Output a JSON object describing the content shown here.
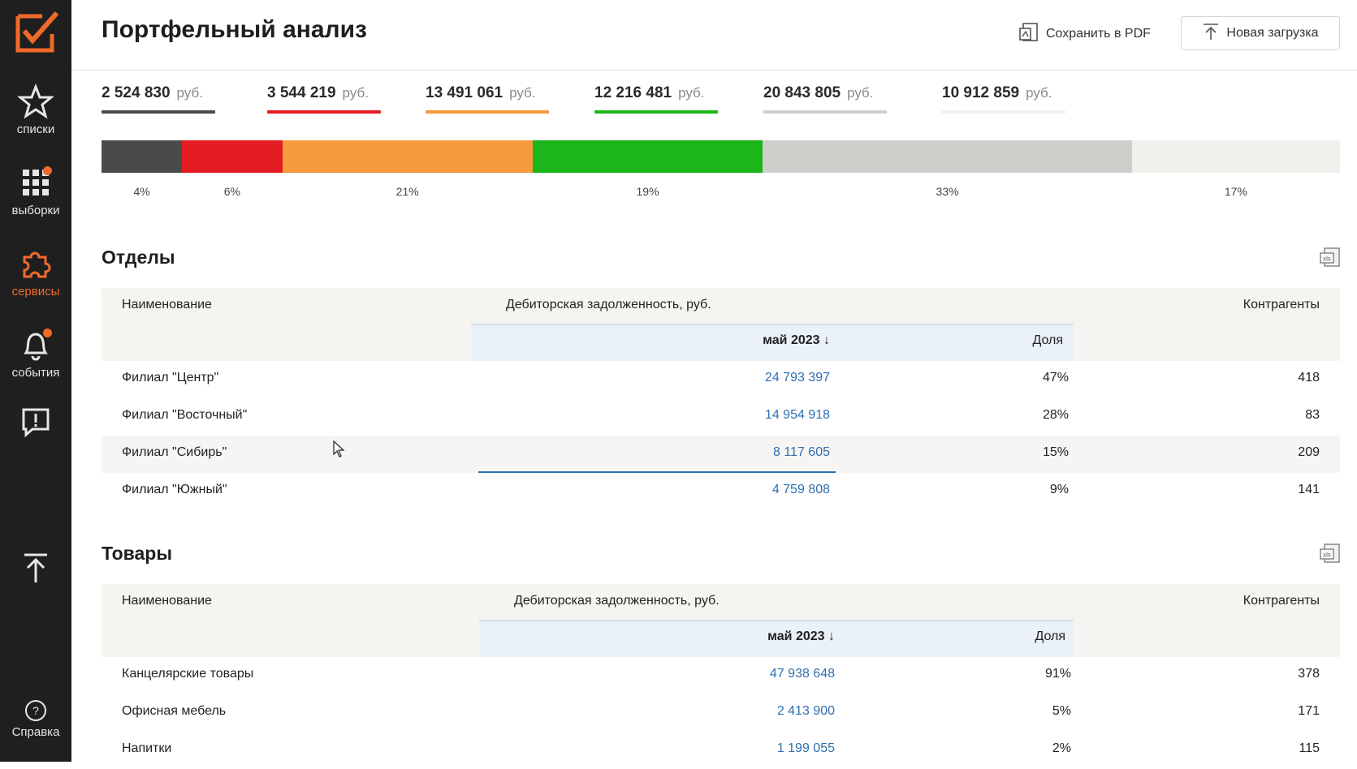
{
  "app": {
    "title": "Портфельный анализ",
    "accent": "#f06a2a"
  },
  "sidebar": {
    "items": [
      {
        "label": "списки",
        "icon": "star-icon"
      },
      {
        "label": "выборки",
        "icon": "grid-icon",
        "badge": true
      },
      {
        "label": "сервисы",
        "icon": "puzzle-icon",
        "active": true
      },
      {
        "label": "события",
        "icon": "bell-icon",
        "badge": true
      },
      {
        "label": "",
        "icon": "feedback-icon"
      },
      {
        "label": "",
        "icon": "upload-arrow-icon"
      },
      {
        "label": "Справка",
        "icon": "help-icon"
      }
    ]
  },
  "header": {
    "save_pdf_label": "Сохранить в PDF",
    "new_upload_label": "Новая загрузка"
  },
  "summary": {
    "currency": "руб.",
    "amounts": [
      {
        "value": "2 524 830",
        "color": "#4a4a4a"
      },
      {
        "value": "3 544 219",
        "color": "#e31b23"
      },
      {
        "value": "13 491 061",
        "color": "#f59b3d"
      },
      {
        "value": "12 216 481",
        "color": "#1cb51a"
      },
      {
        "value": "20 843 805",
        "color": "#d0cecb"
      },
      {
        "value": "10 912 859",
        "color": "#f1f0ec"
      }
    ],
    "distribution": [
      {
        "pct": "4%",
        "share": 0.065,
        "color": "#4a4a4a"
      },
      {
        "pct": "6%",
        "share": 0.081,
        "color": "#e31b23"
      },
      {
        "pct": "21%",
        "share": 0.202,
        "color": "#f59b3d"
      },
      {
        "pct": "19%",
        "share": 0.186,
        "color": "#1cb51a"
      },
      {
        "pct": "33%",
        "share": 0.298,
        "color": "#d0cecb"
      },
      {
        "pct": "17%",
        "share": 0.168,
        "color": "#f1f0ec"
      }
    ]
  },
  "departments": {
    "title": "Отделы",
    "columns": {
      "name": "Наименование",
      "debt": "Дебиторская задолженность, руб.",
      "period": "май 2023 ↓",
      "share": "Доля",
      "counterparties": "Контрагенты"
    },
    "rows": [
      {
        "name": "Филиал \"Центр\"",
        "amount": "24 793 397",
        "share": "47%",
        "count": "418"
      },
      {
        "name": "Филиал \"Восточный\"",
        "amount": "14 954 918",
        "share": "28%",
        "count": "83"
      },
      {
        "name": "Филиал \"Сибирь\"",
        "amount": "8 117 605",
        "share": "15%",
        "count": "209"
      },
      {
        "name": "Филиал \"Южный\"",
        "amount": "4 759 808",
        "share": "9%",
        "count": "141"
      }
    ]
  },
  "products": {
    "title": "Товары",
    "columns": {
      "name": "Наименование",
      "debt": "Дебиторская задолженность, руб.",
      "period": "май 2023 ↓",
      "share": "Доля",
      "counterparties": "Контрагенты"
    },
    "rows": [
      {
        "name": "Канцелярские товары",
        "amount": "47 938 648",
        "share": "91%",
        "count": "378"
      },
      {
        "name": "Офисная мебель",
        "amount": "2 413 900",
        "share": "5%",
        "count": "171"
      },
      {
        "name": "Напитки",
        "amount": "1 199 055",
        "share": "2%",
        "count": "115"
      }
    ]
  }
}
